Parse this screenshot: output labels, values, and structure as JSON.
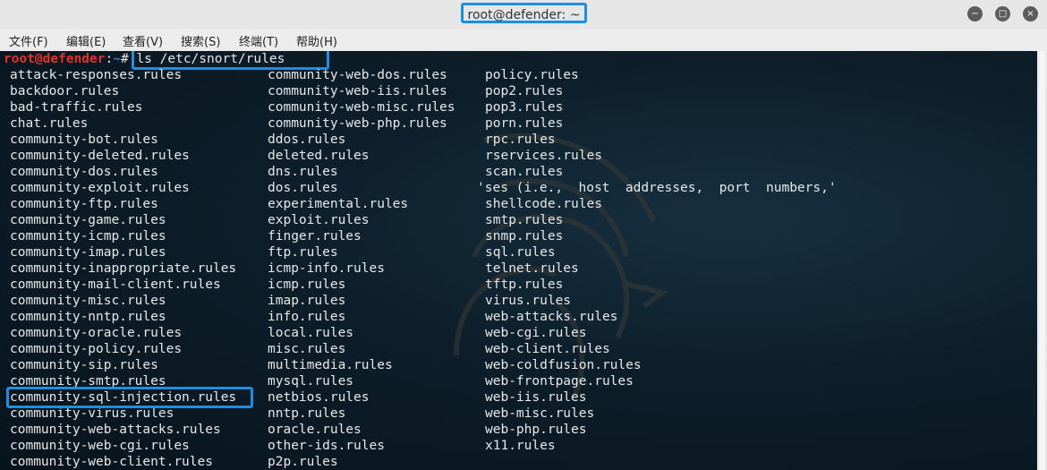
{
  "window": {
    "title": "root@defender: ~",
    "controls": {
      "minimize_icon": "−",
      "maximize_icon": "□",
      "close_icon": "×"
    }
  },
  "menu": [
    "文件(F)",
    "编辑(E)",
    "查看(V)",
    "搜索(S)",
    "终端(T)",
    "帮助(H)"
  ],
  "prompt": {
    "user": "root@defender",
    "sep": ":",
    "path": "~",
    "symbol": "#",
    "command": "ls /etc/snort/rules"
  },
  "columns": [
    [
      "attack-responses.rules",
      "backdoor.rules",
      "bad-traffic.rules",
      "chat.rules",
      "community-bot.rules",
      "community-deleted.rules",
      "community-dos.rules",
      "community-exploit.rules",
      "community-ftp.rules",
      "community-game.rules",
      "community-icmp.rules",
      "community-imap.rules",
      "community-inappropriate.rules",
      "community-mail-client.rules",
      "community-misc.rules",
      "community-nntp.rules",
      "community-oracle.rules",
      "community-policy.rules",
      "community-sip.rules",
      "community-smtp.rules",
      "community-sql-injection.rules",
      "community-virus.rules",
      "community-web-attacks.rules",
      "community-web-cgi.rules",
      "community-web-client.rules"
    ],
    [
      "community-web-dos.rules",
      "community-web-iis.rules",
      "community-web-misc.rules",
      "community-web-php.rules",
      "ddos.rules",
      "deleted.rules",
      "dns.rules",
      "dos.rules",
      "experimental.rules",
      "exploit.rules",
      "finger.rules",
      "ftp.rules",
      "icmp-info.rules",
      "icmp.rules",
      "imap.rules",
      "info.rules",
      "local.rules",
      "misc.rules",
      "multimedia.rules",
      "mysql.rules",
      "netbios.rules",
      "nntp.rules",
      "oracle.rules",
      "other-ids.rules",
      "p2p.rules"
    ],
    [
      "policy.rules",
      "pop2.rules",
      "pop3.rules",
      "porn.rules",
      "rpc.rules",
      "rservices.rules",
      "scan.rules",
      "'ses (i.e.,  host  addresses,  port  numbers,'",
      "shellcode.rules",
      "smtp.rules",
      "snmp.rules",
      "sql.rules",
      "telnet.rules",
      "tftp.rules",
      "virus.rules",
      "web-attacks.rules",
      "web-cgi.rules",
      "web-client.rules",
      "web-coldfusion.rules",
      "web-frontpage.rules",
      "web-iis.rules",
      "web-misc.rules",
      "web-php.rules",
      "x11.rules"
    ]
  ],
  "highlighted_file": "community-sql-injection.rules",
  "colors": {
    "accent_highlight": "#1a8fe3",
    "prompt_user": "#e4322b",
    "prompt_path": "#2b7bd8",
    "terminal_bg": "#0d1e2a"
  }
}
